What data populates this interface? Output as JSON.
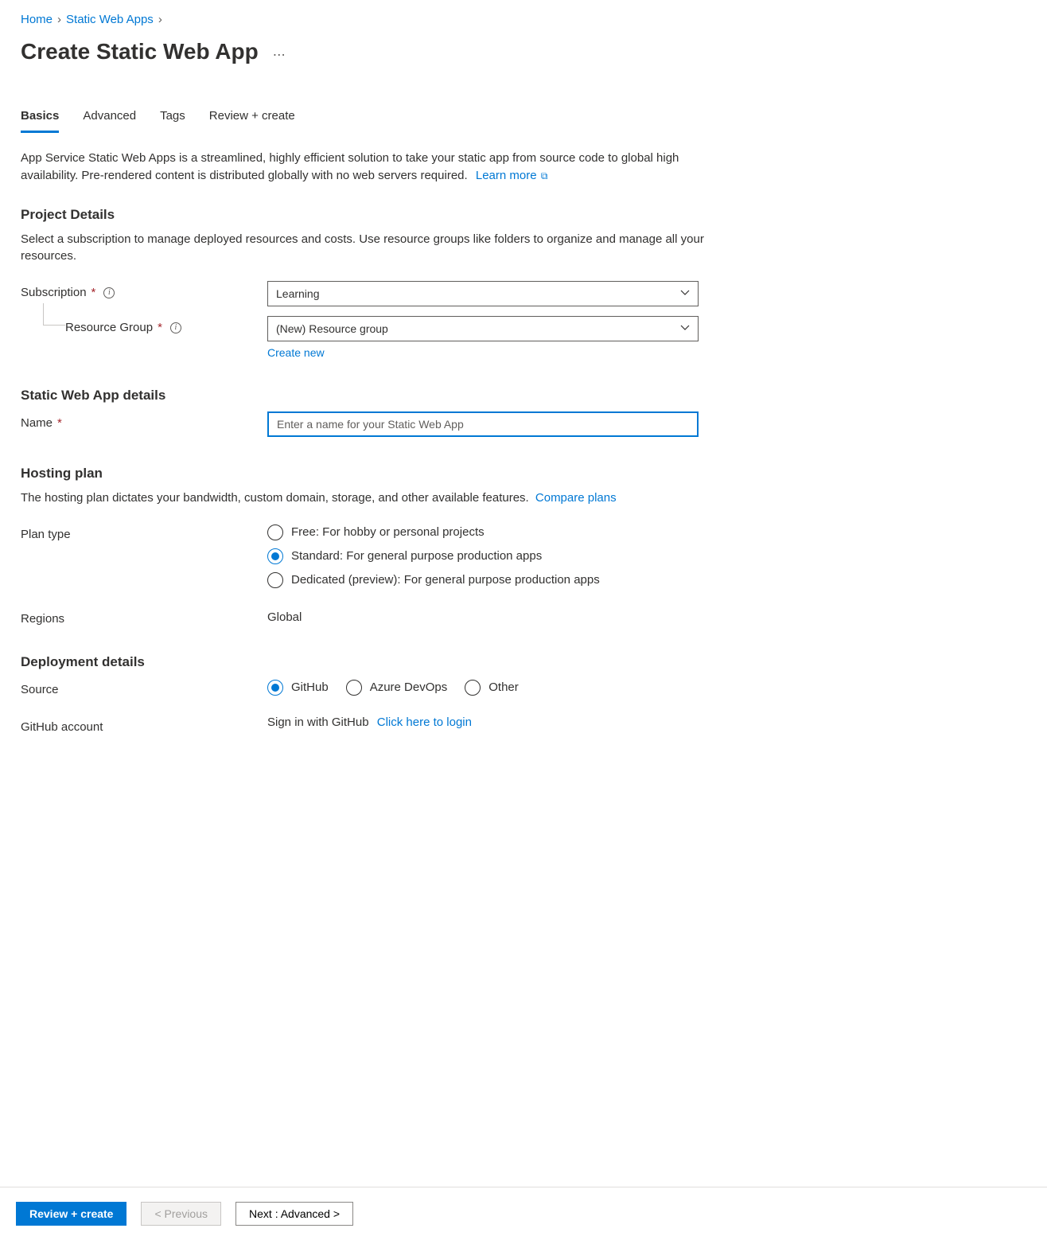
{
  "breadcrumb": {
    "home": "Home",
    "parent": "Static Web Apps"
  },
  "page_title": "Create Static Web App",
  "tabs": {
    "basics": "Basics",
    "advanced": "Advanced",
    "tags": "Tags",
    "review": "Review + create"
  },
  "intro": {
    "text": "App Service Static Web Apps is a streamlined, highly efficient solution to take your static app from source code to global high availability. Pre-rendered content is distributed globally with no web servers required.",
    "learn_more": "Learn more"
  },
  "project_details": {
    "heading": "Project Details",
    "desc": "Select a subscription to manage deployed resources and costs. Use resource groups like folders to organize and manage all your resources.",
    "subscription_label": "Subscription",
    "subscription_value": "Learning",
    "resource_group_label": "Resource Group",
    "resource_group_value": "(New) Resource group",
    "create_new": "Create new"
  },
  "app_details": {
    "heading": "Static Web App details",
    "name_label": "Name",
    "name_placeholder": "Enter a name for your Static Web App"
  },
  "hosting_plan": {
    "heading": "Hosting plan",
    "desc": "The hosting plan dictates your bandwidth, custom domain, storage, and other available features.",
    "compare_link": "Compare plans",
    "plan_type_label": "Plan type",
    "options": {
      "free": "Free: For hobby or personal projects",
      "standard": "Standard: For general purpose production apps",
      "dedicated": "Dedicated (preview): For general purpose production apps"
    },
    "regions_label": "Regions",
    "regions_value": "Global"
  },
  "deployment": {
    "heading": "Deployment details",
    "source_label": "Source",
    "sources": {
      "github": "GitHub",
      "ado": "Azure DevOps",
      "other": "Other"
    },
    "github_account_label": "GitHub account",
    "signin_text": "Sign in with GitHub",
    "signin_link": "Click here to login"
  },
  "footer": {
    "review": "Review + create",
    "previous": "< Previous",
    "next": "Next : Advanced >"
  }
}
